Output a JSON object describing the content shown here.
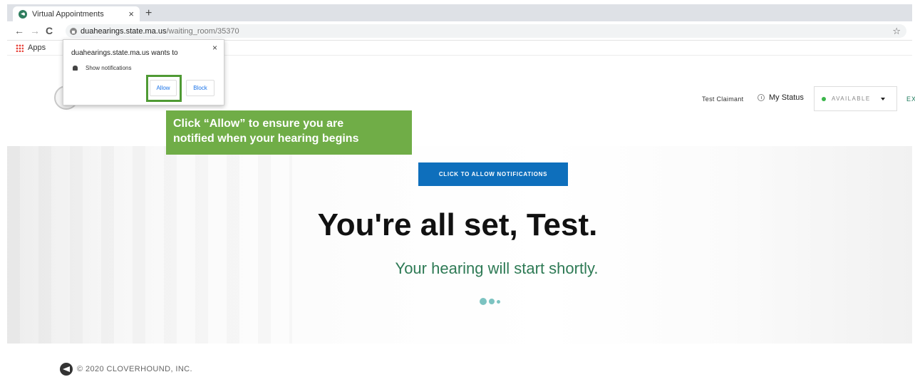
{
  "browser": {
    "tab_title": "Virtual Appointments",
    "tab_close": "×",
    "new_tab": "+",
    "back": "←",
    "forward": "→",
    "reload": "C",
    "url_host": "duahearings.state.ma.us",
    "url_path": "/waiting_room/35370",
    "bookmark_star": "☆",
    "bookmarks_apps": "Apps"
  },
  "header": {
    "user_name": "Test Claimant",
    "my_status_label": "My Status",
    "status_value": "AVAILABLE",
    "exit_label": "EXIT"
  },
  "permission_popup": {
    "title": "duahearings.state.ma.us wants to",
    "close": "×",
    "permission": "Show notifications",
    "allow_label": "Allow",
    "block_label": "Block"
  },
  "callout": {
    "line1": "Click “Allow” to ensure you are",
    "line2": "notified when your hearing begins"
  },
  "main": {
    "notify_button": "CLICK TO ALLOW NOTIFICATIONS",
    "headline": "You're all set, Test.",
    "subline": "Your hearing will start shortly."
  },
  "footer": {
    "copyright": "© 2020 CLOVERHOUND, INC."
  },
  "colors": {
    "accent_green": "#2e7a55",
    "button_blue": "#0e6fbc",
    "callout_green": "#70ad47",
    "status_green": "#3ab54a"
  }
}
